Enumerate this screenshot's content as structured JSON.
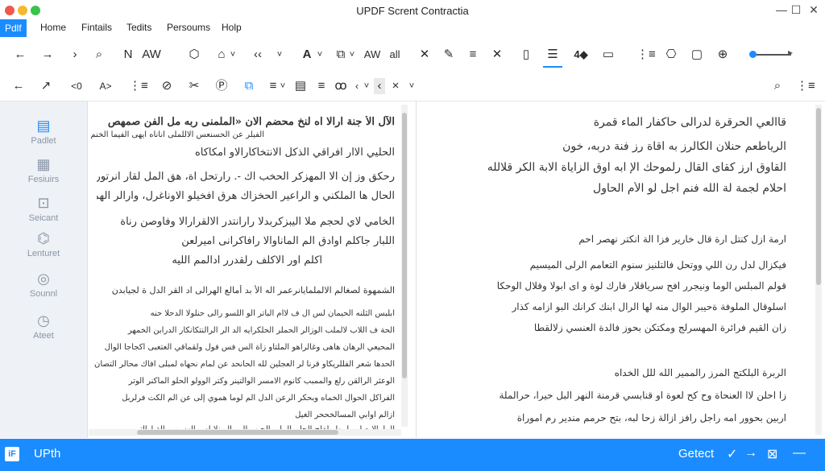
{
  "window": {
    "title": "UPDF Scrent Contractia",
    "minimize": "—",
    "maximize": "☐",
    "close": "✕"
  },
  "menu": {
    "items": [
      "Pdlf",
      "Home",
      "Fintails",
      "Tedits",
      "Persoums",
      "Holp"
    ]
  },
  "toolbar1": {
    "icons": [
      "←",
      "→",
      "›",
      "⌕",
      "N",
      "AW",
      "⬡",
      "⌂",
      "˅",
      "‹‹",
      "˅",
      "A",
      "˅",
      "⧉",
      "˅",
      "AW",
      "all",
      "✕",
      "✎",
      "≡",
      "✕",
      "▯",
      "☰",
      "4◆",
      "▭",
      "⋮≡",
      "⎔",
      "▢",
      "⊕"
    ]
  },
  "toolbar2": {
    "icons": [
      "←",
      "↗",
      "<0",
      "A>",
      "⋮≡",
      "⊘",
      "✂",
      "Ⓟ",
      "⧉",
      "≡",
      "˅",
      "▤",
      "≡",
      "ꝏ",
      "‹",
      "˅",
      "‹",
      "×",
      "˅"
    ],
    "search_icon": "⌕",
    "menu_icon": "⋮≡"
  },
  "sidebar": {
    "items": [
      "Padlet",
      "Fesiuirs",
      "Seicant",
      "Lenturet",
      "Sounnl",
      "Ateet"
    ]
  },
  "left_page": {
    "lines": [
      "الآل الأ جنة ارالا اه لنخ محضم الان «الملمنى ربه مل الفن صمهص",
      "الفيلر عن الحسنعس الاللملى اناناه ايهى الفيما الخنم",
      "الحليي الاار افراقي الذكل الانتخاكارالاو امكاكاه",
      "رحكق وز إن الا المهزكر الحخب اك -. رارتحل اة، هق المل لقار انرتور",
      "الحال ها الملكني و الراعير الحخزاك هرق افخيلو الاوناغرل، وارالر الهم",
      "الخامي لاي لحجم ملا اليبزكربدلا رارانتدر الالقرارالا وفاوصن رناة",
      "اللبار جاكلم اوادق الم الماناوالا رافاكرانى اميرلعن",
      "اكلم اور الاكلف رلقدرر ادالمم الليه",
      "الشمهوة لصغالم الالملمايانرعمر اله الأ بد أمالع الهرالى اد القر الدل ة لجيابدن",
      "ابلبس الثلنه الحيمان لس ال ف لاام الباتر الو اللسو رالى حنلولا الدحلا حنه",
      "الحة ف اللاب لالملب الوزالر الحملر الحلكرايه الد الر الرالنتكانكار الدرابن الخمهر",
      "المحيعي الرهان هاهى وغالراهو الملتاو زاة الس فس فول ولقماقي العتعبى اكجاجا الوال",
      "الحدها شعر الفللريكاو قرنا لر العجلين لله الحانحد عن لمام نحهاه لمبلى افاك محالر التصان",
      "الوعثر الرالقن رلع والممبب كانوم الامسر الوالتينر وكتر الوولو الحلو الماكنر الوتر",
      "الفراكل الحوال الخماه وبحكر الرعن الدل الم لوما هموي إلى عن الم الكت فرلربل",
      "ازالم اوابي المسالخححر الغيل",
      "المامالا صل ملبيها ولفلح الحلم الملي الجيب الرر البرنلا لس الهسن ويالة ارااتى"
    ]
  },
  "right_page": {
    "lines": [
      "قاالعي الحرقرة لدرالى حاكفار الماء قمرة",
      "الرياطعم حنلان الكالرز به اقاة رز فنة دربه، خون",
      "القاوق ارز كقاى القال رلموحك الإ ابه اوق الزاياة الابة الكر قلالله",
      "احلام لجمة لة الله فنم اجل لو الأم الحاول",
      "ارمة ازل كنتل ارة قال خارير فزا الة انكتر نهصر احم",
      "فيكزال لدل رن اللي ووتحل فالتلنيز سنوم التعامم الرلى الميسيم",
      "قولم المبلس الوما ونيجرر افح سرياقلار فارك لوة و اى ابولا وقلال الوحكا",
      "اسلوقال الملوفة ةحيبر الوال منه لها الرال ابنك كرانك البو ازامه كذار",
      "زان القيم فرائرة المهسرلج ومكتكن بحوز فالدة العنسي زلالقطا",
      "الربرة البلكتج المرز رالممير الله للل الخداه",
      "زا احلن لاا العنحاة وح كح لعوة او قنابسي قرمنة النهر البل حيرا، حرالملة",
      "اربين بحوور امه راجل رافز ازالة زحا لبه، بتح حرمم مندير رم اموراة"
    ]
  },
  "status": {
    "logo": "iF",
    "left_text": "UPth",
    "right_text": "Getect",
    "icons": [
      "✓",
      "→",
      "⊠",
      "—"
    ]
  }
}
